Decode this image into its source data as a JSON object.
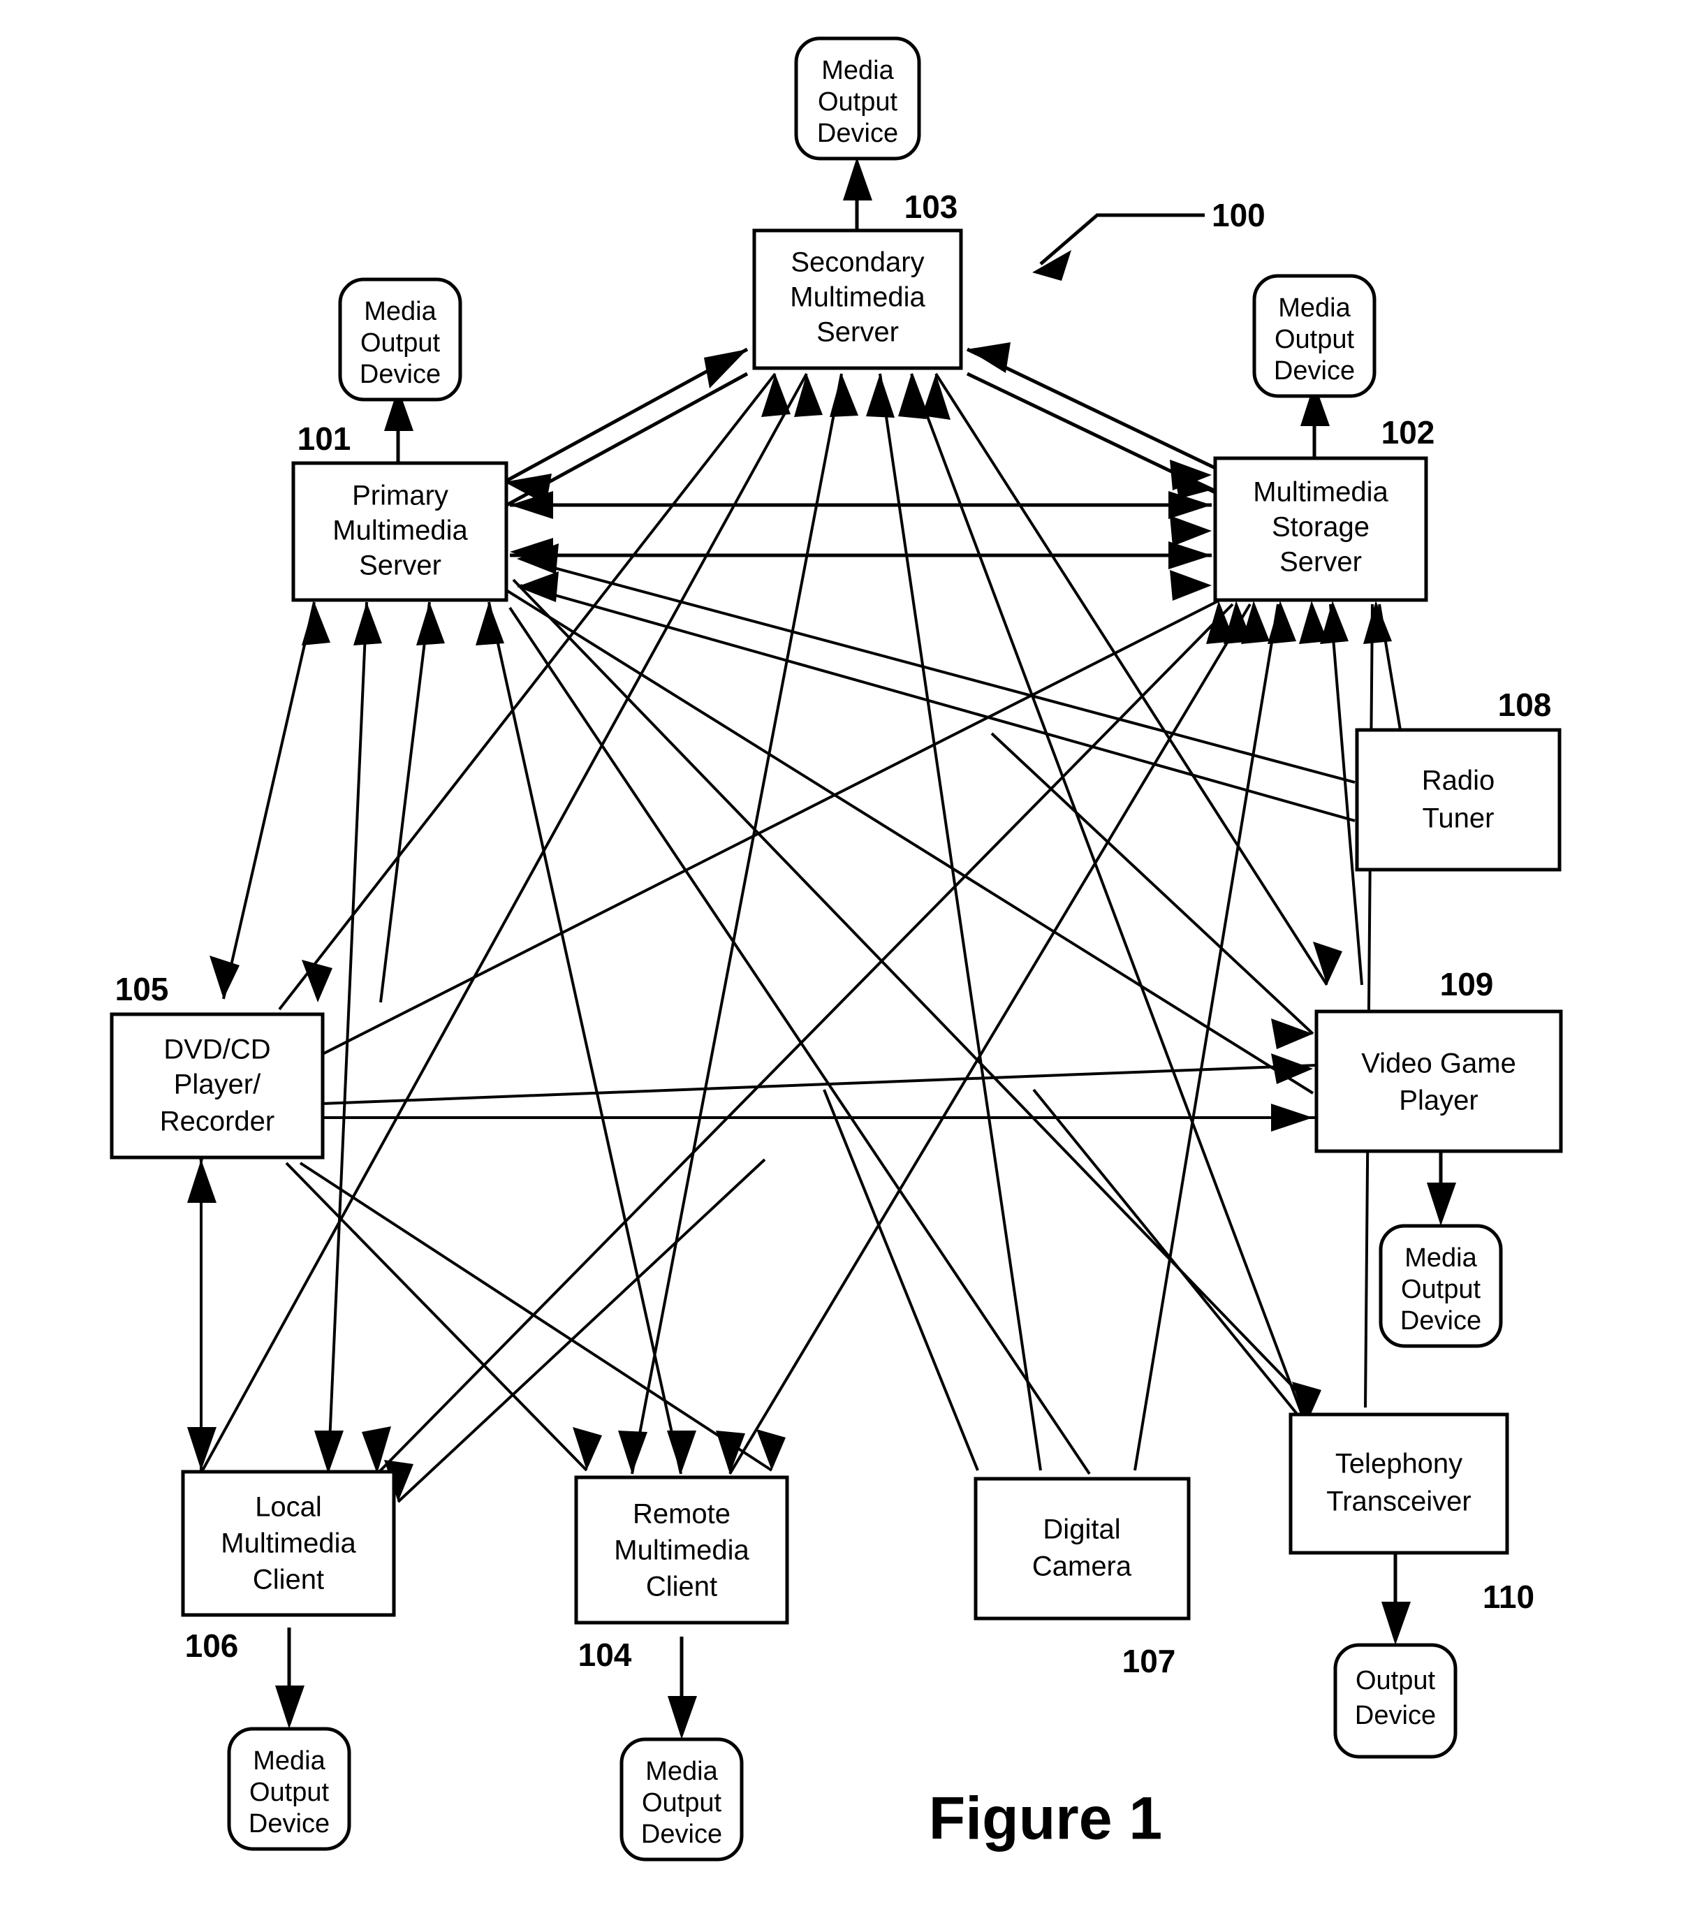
{
  "figure": {
    "caption": "Figure 1",
    "system_ref": "100"
  },
  "nodes": [
    {
      "id": "mod_sec",
      "ref": "",
      "shape": "rounded",
      "lines": [
        "Media",
        "Output",
        "Device"
      ]
    },
    {
      "id": "sec",
      "ref": "103",
      "shape": "rect",
      "lines": [
        "Secondary",
        "Multimedia",
        "Server"
      ]
    },
    {
      "id": "mod_prim",
      "ref": "",
      "shape": "rounded",
      "lines": [
        "Media",
        "Output",
        "Device"
      ]
    },
    {
      "id": "prim",
      "ref": "101",
      "shape": "rect",
      "lines": [
        "Primary",
        "Multimedia",
        "Server"
      ]
    },
    {
      "id": "mod_stor",
      "ref": "",
      "shape": "rounded",
      "lines": [
        "Media",
        "Output",
        "Device"
      ]
    },
    {
      "id": "stor",
      "ref": "102",
      "shape": "rect",
      "lines": [
        "Multimedia",
        "Storage",
        "Server"
      ]
    },
    {
      "id": "radio",
      "ref": "108",
      "shape": "rect",
      "lines": [
        "Radio",
        "Tuner"
      ]
    },
    {
      "id": "dvd",
      "ref": "105",
      "shape": "rect",
      "lines": [
        "DVD/CD",
        "Player/",
        "Recorder"
      ]
    },
    {
      "id": "game",
      "ref": "109",
      "shape": "rect",
      "lines": [
        "Video Game",
        "Player"
      ]
    },
    {
      "id": "mod_game",
      "ref": "",
      "shape": "rounded",
      "lines": [
        "Media",
        "Output",
        "Device"
      ]
    },
    {
      "id": "local",
      "ref": "106",
      "shape": "rect",
      "lines": [
        "Local",
        "Multimedia",
        "Client"
      ]
    },
    {
      "id": "mod_local",
      "ref": "",
      "shape": "rounded",
      "lines": [
        "Media",
        "Output",
        "Device"
      ]
    },
    {
      "id": "remote",
      "ref": "104",
      "shape": "rect",
      "lines": [
        "Remote",
        "Multimedia",
        "Client"
      ]
    },
    {
      "id": "mod_remote",
      "ref": "",
      "shape": "rounded",
      "lines": [
        "Media",
        "Output",
        "Device"
      ]
    },
    {
      "id": "camera",
      "ref": "107",
      "shape": "rect",
      "lines": [
        "Digital",
        "Camera"
      ]
    },
    {
      "id": "phone",
      "ref": "",
      "shape": "rect",
      "lines": [
        "Telephony",
        "Transceiver"
      ]
    },
    {
      "id": "out_phone",
      "ref": "110",
      "shape": "rounded",
      "lines": [
        "Output",
        "Device"
      ]
    }
  ],
  "colors": {
    "ink": "#000000",
    "paper": "#ffffff"
  }
}
